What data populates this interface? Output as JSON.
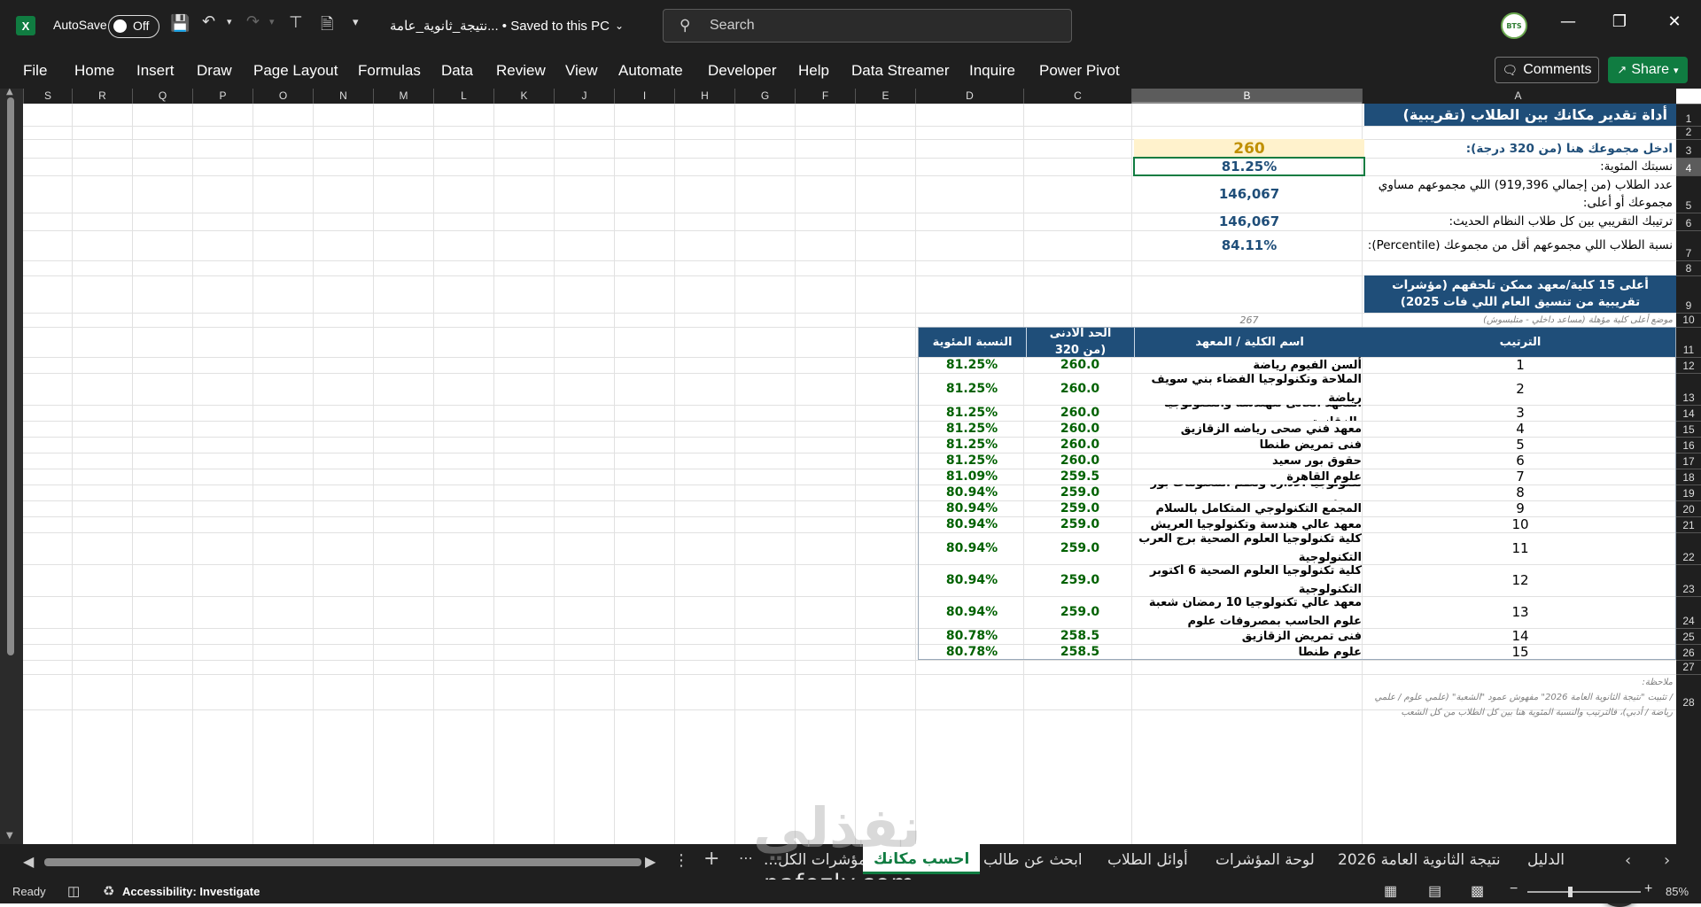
{
  "app": {
    "autosave_label": "AutoSave",
    "autosave_state": "Off",
    "doc_title": "نتيجة_ثانوية_عامة... • Saved to this PC",
    "search_placeholder": "Search",
    "avatar_text": "BTS",
    "comments_label": "Comments",
    "share_label": "Share"
  },
  "menu": [
    "File",
    "Home",
    "Insert",
    "Draw",
    "Page Layout",
    "Formulas",
    "Data",
    "Review",
    "View",
    "Automate",
    "Developer",
    "Help",
    "Data Streamer",
    "Inquire",
    "Power Pivot"
  ],
  "columns": [
    "S",
    "R",
    "Q",
    "P",
    "O",
    "N",
    "M",
    "L",
    "K",
    "J",
    "I",
    "H",
    "G",
    "F",
    "E",
    "D",
    "C",
    "B",
    "A"
  ],
  "rows": [
    "1",
    "2",
    "3",
    "4",
    "5",
    "6",
    "7",
    "8",
    "9",
    "10",
    "11",
    "12",
    "13",
    "14",
    "15",
    "16",
    "17",
    "18",
    "19",
    "20",
    "21",
    "22",
    "23",
    "24",
    "25",
    "26",
    "27",
    "28"
  ],
  "selected_column": "B",
  "selected_row": "4",
  "sheet": {
    "title": "أداة تقدير مكانك بين الطلاب (تقريبية)",
    "input_label": "ادخل مجموعك هنا (من 320 درجة):",
    "input_value": "260",
    "pct_label": "نسبتك المئوية:",
    "pct_value": "81.25%",
    "count_label": "عدد الطلاب (من إجمالي 919,396) اللي مجموعهم مساوي مجموعك أو أعلى:",
    "count_value": "146,067",
    "rank_label": "ترتيبك التقريبي بين كل طلاب النظام الحديث:",
    "rank_value": "146,067",
    "percentile_label": "نسبة الطلاب اللي مجموعهم أقل من مجموعك (Percentile):",
    "percentile_value": "84.11%",
    "top_title": "أعلى 15 كلية/معهد ممكن تلحقهم (مؤشرات تقريبية من تنسيق العام اللي فات 2025)",
    "note": "موضع أعلى كلية مؤهلة (مساعد داخلي - متلبسوش)",
    "note_value": "267",
    "headers": {
      "rank": "الترتيب",
      "name": "اسم الكلية / المعهد",
      "min": "الحد الأدنى (من 320",
      "pct": "النسبة المئوية"
    },
    "colleges": [
      {
        "rank": "1",
        "name": "ألسن الفيوم رياضة",
        "min": "260.0",
        "pct": "81.25%"
      },
      {
        "rank": "2",
        "name": "الملاحة وتكنولوجيا الفضاء بني سويف رياضة",
        "min": "260.0",
        "pct": "81.25%"
      },
      {
        "rank": "3",
        "name": "المعهد العالى للهندسة والتكنولوجيا بالزقازيق",
        "min": "260.0",
        "pct": "81.25%"
      },
      {
        "rank": "4",
        "name": "معهد فني صحى رياضه الزقازيق",
        "min": "260.0",
        "pct": "81.25%"
      },
      {
        "rank": "5",
        "name": "فنى تمريض طنطا",
        "min": "260.0",
        "pct": "81.25%"
      },
      {
        "rank": "6",
        "name": "حقوق بور سعيد",
        "min": "260.0",
        "pct": "81.25%"
      },
      {
        "rank": "7",
        "name": "علوم القاهرة",
        "min": "259.5",
        "pct": "81.09%"
      },
      {
        "rank": "8",
        "name": "تكنولوجيا الادارة ونظم المعلومات بور سعيد",
        "min": "259.0",
        "pct": "80.94%"
      },
      {
        "rank": "9",
        "name": "المجمع التكنولوجي المتكامل بالسلام",
        "min": "259.0",
        "pct": "80.94%"
      },
      {
        "rank": "10",
        "name": "معهد عالي هندسة وتكنولوجيا العريش",
        "min": "259.0",
        "pct": "80.94%"
      },
      {
        "rank": "11",
        "name": "كلية تكنولوجيا العلوم الصحية برج العرب التكنولوجية",
        "min": "259.0",
        "pct": "80.94%"
      },
      {
        "rank": "12",
        "name": "كلية تكنولوجيا العلوم الصحية 6 أكتوبر التكنولوجية",
        "min": "259.0",
        "pct": "80.94%"
      },
      {
        "rank": "13",
        "name": "معهد عالي تكنولوجيا 10 رمضان شعبة علوم الحاسب بمصروفات علوم",
        "min": "259.0",
        "pct": "80.94%"
      },
      {
        "rank": "14",
        "name": "فنى تمريض الزقازيق",
        "min": "258.5",
        "pct": "80.78%"
      },
      {
        "rank": "15",
        "name": "علوم طنطا",
        "min": "258.5",
        "pct": "80.78%"
      }
    ],
    "footnote_title": "ملاحظة:",
    "footnote": "/ تثبيت \"نتيجة الثانوية العامة 2026\" مفهوش عمود \"الشعبة\" (علمي علوم / علمي رياضة / أدبي)، فالترتيب والنسبة المئوية هنا بين كل الطلاب من كل الشعب"
  },
  "tabs": [
    "الدليل",
    "نتيجة الثانوية العامة 2026",
    "لوحة المؤشرات",
    "أوائل الطلاب",
    "ابحث عن طالب",
    "احسب مكانك",
    "مؤشرات الكل..."
  ],
  "active_tab": "احسب مكانك",
  "status": {
    "ready": "Ready",
    "accessibility": "Accessibility: Investigate",
    "zoom": "85%"
  },
  "watermark": {
    "arabic": "نفذلي",
    "latin": "nafezly.com"
  }
}
